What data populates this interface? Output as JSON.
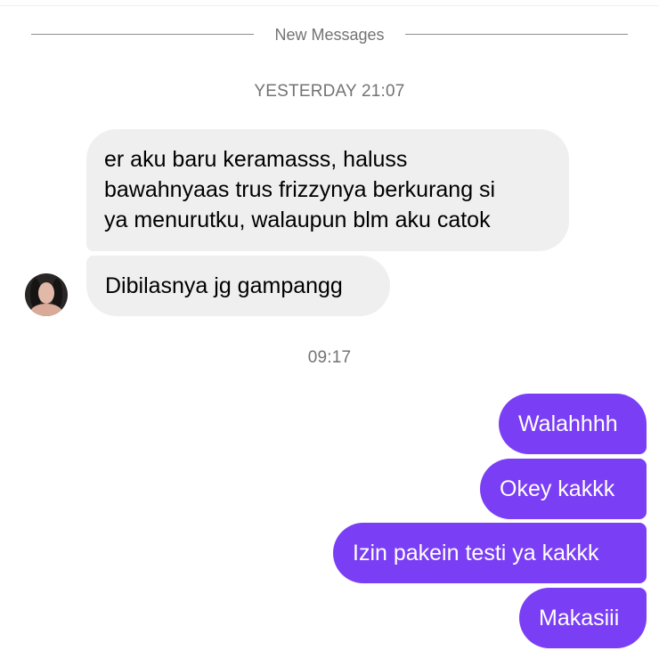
{
  "divider": {
    "label": "New Messages"
  },
  "timestamps": {
    "yesterday": "YESTERDAY 21:07",
    "today": "09:17"
  },
  "incoming": {
    "message_1_lines": [
      "er aku baru keramasss, haluss",
      "bawahnyaas trus frizzynya berkurang si",
      "ya menurutku, walaupun blm aku catok"
    ],
    "message_2": "Dibilasnya jg gampangg"
  },
  "outgoing": {
    "messages": [
      "Walahhhh",
      "Okey kakkk",
      "Izin pakein testi ya kakkk",
      "Makasiii"
    ]
  },
  "colors": {
    "outgoing_bubble": "#7a3ef5",
    "incoming_bubble": "#efefef",
    "timestamp_text": "#737373"
  }
}
